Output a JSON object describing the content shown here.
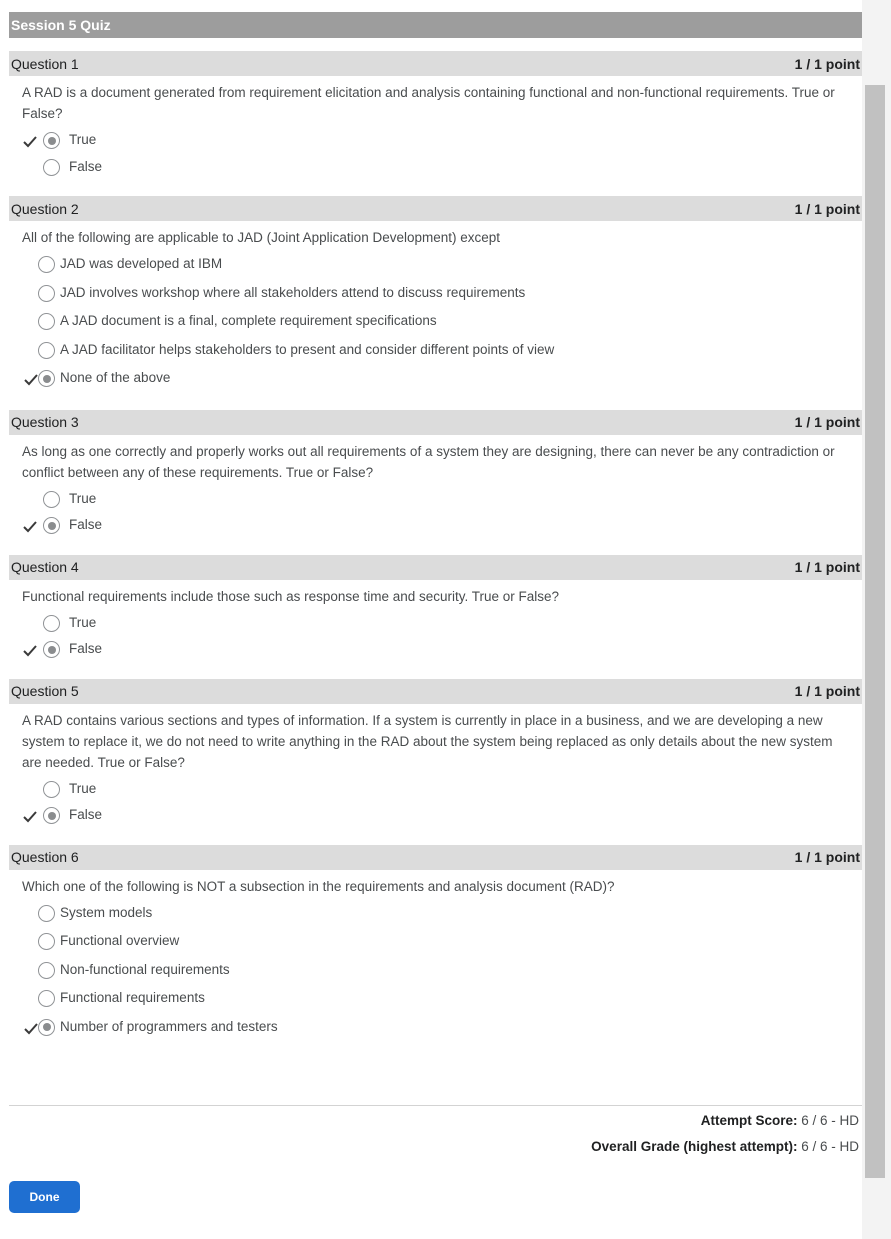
{
  "quiz": {
    "title": "Session 5 Quiz",
    "questions": [
      {
        "header": "Question 1",
        "points": "1 / 1 point",
        "text": "A RAD is a document generated from requirement elicitation and analysis containing functional and non-functional requirements. True or False?",
        "options": [
          {
            "label": "True",
            "selected": true,
            "correct": true
          },
          {
            "label": "False",
            "selected": false,
            "correct": false
          }
        ]
      },
      {
        "header": "Question 2",
        "points": "1 / 1 point",
        "text": "All of the following are applicable to JAD (Joint Application Development) except",
        "options": [
          {
            "label": "JAD was developed at IBM",
            "selected": false,
            "correct": false
          },
          {
            "label": "JAD involves workshop where all stakeholders attend to discuss requirements",
            "selected": false,
            "correct": false
          },
          {
            "label": "A JAD document is a final, complete requirement specifications",
            "selected": false,
            "correct": false
          },
          {
            "label": "A JAD facilitator helps stakeholders to present and consider different points of view",
            "selected": false,
            "correct": false
          },
          {
            "label": "None of the above",
            "selected": true,
            "correct": true
          }
        ]
      },
      {
        "header": "Question 3",
        "points": "1 / 1 point",
        "text": "As long as one correctly and properly works out all requirements of a system they are designing, there can never be any contradiction or conflict between any of these requirements. True or False?",
        "options": [
          {
            "label": "True",
            "selected": false,
            "correct": false
          },
          {
            "label": "False",
            "selected": true,
            "correct": true
          }
        ]
      },
      {
        "header": "Question 4",
        "points": "1 / 1 point",
        "text": "Functional requirements include those such as response time and security. True or False?",
        "options": [
          {
            "label": "True",
            "selected": false,
            "correct": false
          },
          {
            "label": "False",
            "selected": true,
            "correct": true
          }
        ]
      },
      {
        "header": "Question 5",
        "points": "1 / 1 point",
        "text": "A RAD contains various sections and types of information. If a system is currently in place in a business, and we are developing a new system to replace it, we do not need to write anything in the RAD about the system being replaced as only details about the new system are needed. True or False?",
        "options": [
          {
            "label": "True",
            "selected": false,
            "correct": false
          },
          {
            "label": "False",
            "selected": true,
            "correct": true
          }
        ]
      },
      {
        "header": "Question 6",
        "points": "1 / 1 point",
        "text": "Which one of the following is NOT a subsection in the requirements and analysis document (RAD)?",
        "options": [
          {
            "label": "System models",
            "selected": false,
            "correct": false
          },
          {
            "label": "Functional overview",
            "selected": false,
            "correct": false
          },
          {
            "label": "Non-functional requirements",
            "selected": false,
            "correct": false
          },
          {
            "label": "Functional requirements",
            "selected": false,
            "correct": false
          },
          {
            "label": "Number of programmers and testers",
            "selected": true,
            "correct": true
          }
        ]
      }
    ]
  },
  "summary": {
    "attempt_label": "Attempt Score:",
    "attempt_value": "6 / 6 - HD",
    "overall_label": "Overall Grade (highest attempt):",
    "overall_value": "6 / 6 - HD"
  },
  "done_button": "Done",
  "colors": {
    "header_bar": "#9d9d9d",
    "question_header": "#dcdcdc",
    "button": "#1f6fd1"
  }
}
